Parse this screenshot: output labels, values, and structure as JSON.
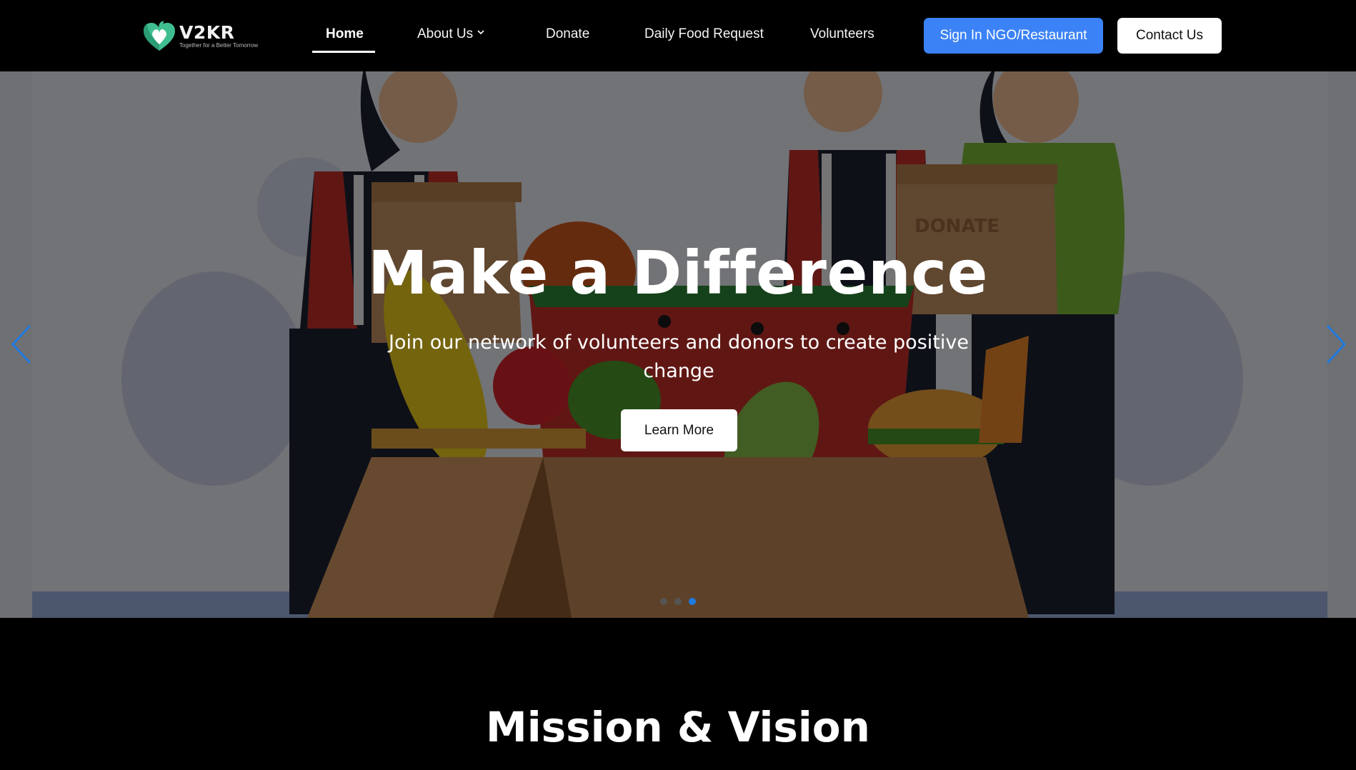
{
  "brand": {
    "name": "V2KR",
    "tagline": "Together for a Better Tomorrow",
    "logo_icon": "heart-hands-leaf-icon",
    "accent_green": "#3fbf8f"
  },
  "nav": {
    "items": [
      {
        "label": "Home",
        "active": true
      },
      {
        "label": "About Us",
        "has_dropdown": true
      },
      {
        "label": "Donate"
      },
      {
        "label": "Daily Food Request"
      },
      {
        "label": "Volunteers"
      }
    ],
    "signin_label": "Sign In NGO/Restaurant",
    "contact_label": "Contact Us"
  },
  "hero": {
    "title": "Make a Difference",
    "subtitle": "Join our network of volunteers and donors to create positive change",
    "cta_label": "Learn More",
    "box_text": "DONATE",
    "slide_count": 3,
    "active_slide": 3,
    "prev_icon": "chevron-left-icon",
    "next_icon": "chevron-right-icon"
  },
  "mission": {
    "title": "Mission & Vision"
  },
  "colors": {
    "primary": "#3b82f6",
    "dot_active": "#1f7ae0",
    "background": "#000000"
  }
}
